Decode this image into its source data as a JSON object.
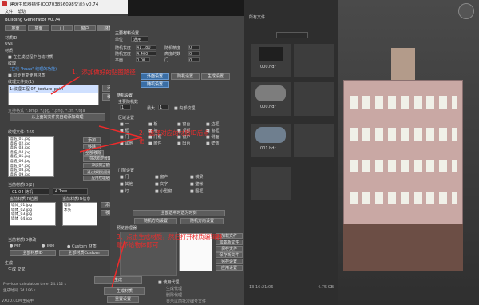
{
  "window": {
    "title": "建筑生成器插件(QQ703856098交流) v0.74",
    "menu": [
      "文件",
      "帮助"
    ]
  },
  "left_panel": {
    "title": "Building Generator v0.74",
    "tabs": [
      "地面",
      "墙面",
      "门",
      "窗户",
      "材质"
    ],
    "section_title": "材质ID",
    "section_uv": "UVs",
    "section_material": "材质",
    "chk_from_model": "在生成过程中自动材质",
    "texture_label": "纹理",
    "hint_blue": "(在线 \"huax\" 纹理的功能)",
    "chk_fix": "同步重复使用材质",
    "texture_folder_label": "纹理文件夹(1)",
    "texture_path_value": "1:纹理工程 07_texture_path",
    "add_btn": "添加",
    "remove_btn": "移除",
    "formats_label": "支持格式 *.bmp, *.jpg, *.png, *.tif, *.tga",
    "load_btn": "从上面的文件夹自动添加纹理",
    "tex_file_label": "纹理文件: 169",
    "file_list": [
      "墙纸_01.jpg",
      "墙纸_02.jpg",
      "墙纸_03.jpg",
      "墙纸_04.jpg",
      "墙纸_05.jpg",
      "墙纸_06.jpg",
      "墙纸_07.jpg",
      "墙纸_08.jpg",
      "墙纸_09.jpg"
    ],
    "side_buttons": [
      "添加",
      "移除",
      "全部移除",
      "筛选指定纹理组",
      "添加到当前组",
      "通过纹理贴图组命名",
      "应用纹理贴图"
    ],
    "cur_id_label": "当前材质ID(2)",
    "cur_id_value": "01-04 随机",
    "mode_value": "4 Tree",
    "slot_label": "当前材质ID位置",
    "slot_right_label": "当前材质ID信息",
    "slot_list_left": [
      "墙体_01.jpg",
      "墙体_02.jpg",
      "墙体_03.jpg",
      "墙体_04.jpg"
    ],
    "slot_list_right": [
      "墙体",
      "木头"
    ],
    "slot_buttons": [
      "添加",
      "移除"
    ],
    "uv_label": "当前材质ID修改",
    "radio_options": [
      "Mir",
      "Tree",
      "Custom 材质"
    ],
    "bottom_btns": [
      "全部材质ID",
      "全部材质Custom"
    ],
    "gen_section": "生成",
    "gen_progress_label": "生成 交叉",
    "time_a_label": "Previous calculation time: 24.112 s",
    "time_b_label": "生成时间: 24.196 s",
    "generate_btn": "生成",
    "generate_material_btn": "生成材质",
    "remove_btn_bottom": "重置设置",
    "status_left": "VXUD.COM 生成中"
  },
  "mid_panel": {
    "title": "主要材料设置",
    "unit_label": "单位",
    "unit_value": "通用",
    "rows": [
      {
        "l": "随机长度",
        "v": "41.180",
        "r": "随机精度",
        "rv": "0"
      },
      {
        "l": "随机宽度",
        "v": "4.400",
        "r": "高度的数",
        "rv": "0"
      },
      {
        "l": "平面",
        "v": "0.00",
        "r": "门",
        "rv": "0"
      }
    ],
    "tab_row": [
      "外面设置",
      "随机设置",
      "生成设置"
    ],
    "tab_active": "随机设置",
    "sec_rand": "随机设置",
    "sub1": "主要随机数",
    "seed_value": "1",
    "max_label": "最大",
    "max_value": "1",
    "chk_inner": "内部纹理",
    "area_label": "区域设置",
    "area_items": [
      "一",
      "板",
      "窗台",
      "边框",
      "框",
      "墙",
      "顶部",
      "窗框",
      "门",
      "门框",
      "窗户",
      "侧面",
      "其他",
      "附件",
      "阳台",
      "壁饰"
    ],
    "door_label": "门窗设置",
    "door_items": [
      "门",
      "窗户",
      "横梁",
      "其他",
      "文字",
      "壁帐",
      "灯",
      "小型窗",
      "图框"
    ],
    "info_btn": "全部选中时选为时刻",
    "dir_btn1": "随机方向设置",
    "dir_btn2": "随机方向设置",
    "preview_label": "预览管理器",
    "preview_buttons": [
      "加载文件",
      "加载新文件",
      "保存文件",
      "保存新文件",
      "另存设置",
      "应用设置"
    ],
    "proxy_label": "使用代理",
    "proxy_opts": [
      "生成代理",
      "删除代理",
      "显示以前批次编号文件"
    ]
  },
  "browser": {
    "header_title": "所有文件",
    "thumbs": [
      {
        "label": "000.hdr"
      },
      {
        "label": ""
      },
      {
        "label": "000.hdr"
      },
      {
        "label": ""
      },
      {
        "label": "001.hdr"
      },
      {
        "label": ""
      }
    ],
    "date": "13 16:21:06",
    "size": "4.75 GB"
  },
  "annotations": {
    "a1": "1、添加做好的贴图路径",
    "a2": "2、选择对应的材质ID后点击",
    "a3": "3、点击生成材质，然后打开材质编辑器赋予给物体即可"
  }
}
